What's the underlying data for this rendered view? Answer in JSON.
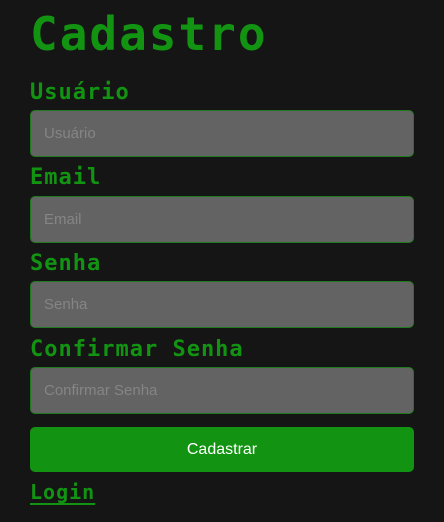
{
  "form": {
    "title": "Cadastro",
    "fields": [
      {
        "label": "Usuário",
        "placeholder": "Usuário",
        "value": ""
      },
      {
        "label": "Email",
        "placeholder": "Email",
        "value": ""
      },
      {
        "label": "Senha",
        "placeholder": "Senha",
        "value": ""
      },
      {
        "label": "Confirmar Senha",
        "placeholder": "Confirmar Senha",
        "value": ""
      }
    ],
    "submit_label": "Cadastrar",
    "login_link": "Login"
  },
  "colors": {
    "background": "#151515",
    "accent_green": "#129412",
    "input_background": "#636363",
    "input_border": "#1f7a1f",
    "button_text": "#ffffff"
  }
}
